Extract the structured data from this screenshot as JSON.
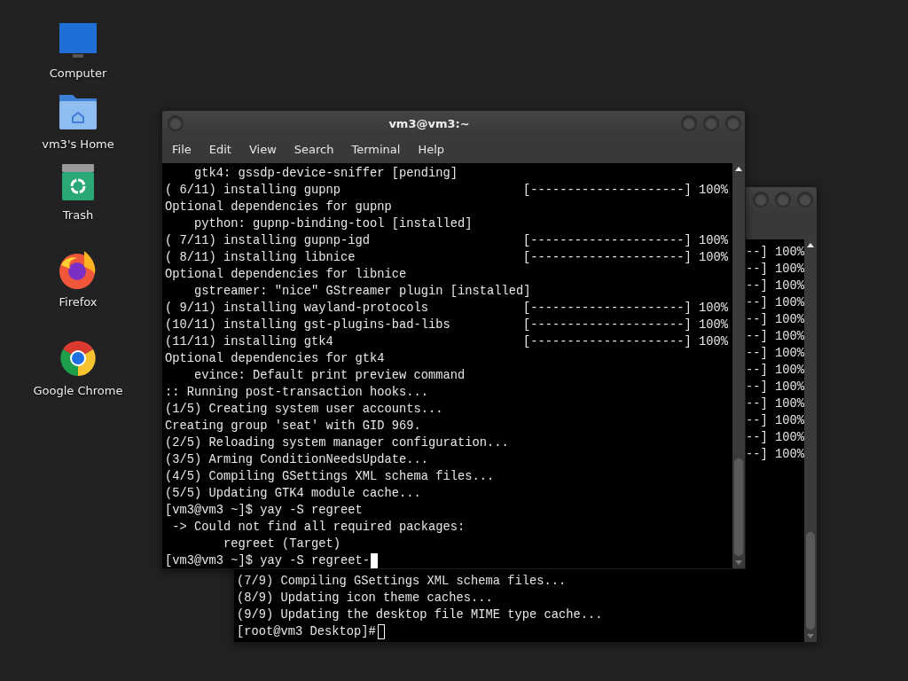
{
  "desktop_icons": [
    {
      "label": "Computer",
      "kind": "computer"
    },
    {
      "label": "vm3's Home",
      "kind": "home"
    },
    {
      "label": "Trash",
      "kind": "trash"
    },
    {
      "label": "Firefox",
      "kind": "firefox"
    },
    {
      "label": "Google Chrome",
      "kind": "chrome"
    }
  ],
  "back_terminal": {
    "focused": false,
    "strip_lines": [
      "--] 100%",
      "--] 100%",
      "--] 100%",
      "--] 100%",
      "--] 100%",
      "--] 100%",
      "--] 100%",
      "--] 100%",
      "--] 100%",
      "--] 100%",
      "--] 100%",
      "--] 100%",
      "--] 100%"
    ],
    "lines": [
      {
        "kind": "text",
        "text": "(7/9) Compiling GSettings XML schema files..."
      },
      {
        "kind": "text",
        "text": "(8/9) Updating icon theme caches..."
      },
      {
        "kind": "text",
        "text": "(9/9) Updating the desktop file MIME type cache..."
      },
      {
        "kind": "prompt",
        "text": "[root@vm3 Desktop]#"
      }
    ]
  },
  "front_terminal": {
    "title": "vm3@vm3:~",
    "focused": true,
    "menu": [
      "File",
      "Edit",
      "View",
      "Search",
      "Terminal",
      "Help"
    ],
    "lines": [
      {
        "kind": "text",
        "text": "    gtk4: gssdp-device-sniffer [pending]"
      },
      {
        "kind": "progress",
        "text": "( 6/11) installing gupnp",
        "bar": "[---------------------]",
        "percent": "100%"
      },
      {
        "kind": "text",
        "text": "Optional dependencies for gupnp"
      },
      {
        "kind": "text",
        "text": "    python: gupnp-binding-tool [installed]"
      },
      {
        "kind": "progress",
        "text": "( 7/11) installing gupnp-igd",
        "bar": "[---------------------]",
        "percent": "100%"
      },
      {
        "kind": "progress",
        "text": "( 8/11) installing libnice",
        "bar": "[---------------------]",
        "percent": "100%"
      },
      {
        "kind": "text",
        "text": "Optional dependencies for libnice"
      },
      {
        "kind": "text",
        "text": "    gstreamer: \"nice\" GStreamer plugin [installed]"
      },
      {
        "kind": "progress",
        "text": "( 9/11) installing wayland-protocols",
        "bar": "[---------------------]",
        "percent": "100%"
      },
      {
        "kind": "progress",
        "text": "(10/11) installing gst-plugins-bad-libs",
        "bar": "[---------------------]",
        "percent": "100%"
      },
      {
        "kind": "progress",
        "text": "(11/11) installing gtk4",
        "bar": "[---------------------]",
        "percent": "100%"
      },
      {
        "kind": "text",
        "text": "Optional dependencies for gtk4"
      },
      {
        "kind": "text",
        "text": "    evince: Default print preview command"
      },
      {
        "kind": "text",
        "text": ":: Running post-transaction hooks..."
      },
      {
        "kind": "text",
        "text": "(1/5) Creating system user accounts..."
      },
      {
        "kind": "text",
        "text": "Creating group 'seat' with GID 969."
      },
      {
        "kind": "text",
        "text": "(2/5) Reloading system manager configuration..."
      },
      {
        "kind": "text",
        "text": "(3/5) Arming ConditionNeedsUpdate..."
      },
      {
        "kind": "text",
        "text": "(4/5) Compiling GSettings XML schema files..."
      },
      {
        "kind": "text",
        "text": "(5/5) Updating GTK4 module cache..."
      },
      {
        "kind": "text",
        "text": "[vm3@vm3 ~]$ yay -S regreet"
      },
      {
        "kind": "text",
        "text": " -> Could not find all required packages:"
      },
      {
        "kind": "text",
        "text": "        regreet (Target)"
      },
      {
        "kind": "prompt",
        "text": "[vm3@vm3 ~]$ yay -S regreet-"
      }
    ]
  }
}
